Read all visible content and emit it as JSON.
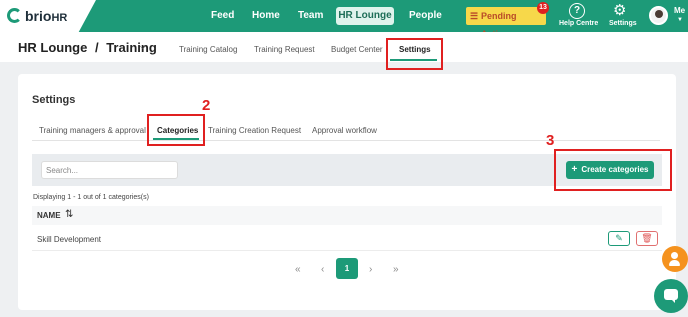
{
  "brand": {
    "logo_main": "brio",
    "logo_suffix": "HR",
    "accent_color": "#1d9a78",
    "alert_color": "#e02020"
  },
  "topnav": {
    "items": [
      {
        "label": "Feed"
      },
      {
        "label": "Home"
      },
      {
        "label": "Team"
      },
      {
        "label": "HR Lounge",
        "active": true
      },
      {
        "label": "People"
      }
    ],
    "pending_actions": {
      "label": "Pending Actions",
      "count": "13",
      "icon": "list-icon"
    },
    "help": {
      "label": "Help Centre",
      "icon": "question-icon"
    },
    "settings": {
      "label": "Settings",
      "icon": "gear-icon"
    },
    "user": {
      "label": "Me",
      "icon": "avatar"
    }
  },
  "breadcrumb": {
    "section": "HR Lounge",
    "separator": "/",
    "page": "Training"
  },
  "subtabs": [
    {
      "label": "Training Catalog"
    },
    {
      "label": "Training Request"
    },
    {
      "label": "Budget Center"
    },
    {
      "label": "Settings",
      "active": true
    }
  ],
  "annotations": {
    "step2": "2",
    "step3": "3"
  },
  "settings_card": {
    "title": "Settings",
    "tabs": [
      {
        "label": "Training managers & approval"
      },
      {
        "label": "Categories",
        "active": true
      },
      {
        "label": "Training Creation Request"
      },
      {
        "label": "Approval workflow"
      }
    ],
    "search": {
      "placeholder": "Search...",
      "value": ""
    },
    "create_button": {
      "icon": "+",
      "label": "Create categories"
    },
    "displaying": "Displaying 1 - 1 out of 1 categories(s)",
    "table": {
      "columns": [
        {
          "label": "NAME",
          "sort_icon": "⇅"
        }
      ],
      "rows": [
        {
          "name": "Skill Development"
        }
      ]
    },
    "pagination": {
      "first": "«",
      "prev": "‹",
      "current": "1",
      "next": "›",
      "last": "»"
    }
  }
}
